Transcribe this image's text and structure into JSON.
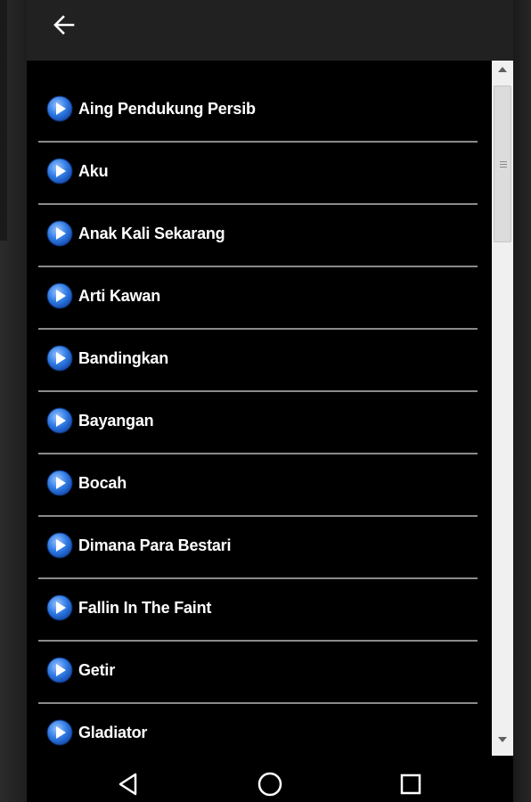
{
  "app_bar": {
    "back_icon": "arrow-left-icon"
  },
  "songs": [
    "Aing Pendukung Persib",
    "Aku",
    "Anak Kali Sekarang",
    "Arti Kawan",
    "Bandingkan",
    "Bayangan",
    "Bocah",
    "Dimana Para Bestari",
    "Fallin In The Faint",
    "Getir",
    "Gladiator"
  ],
  "item_icon": "play-icon",
  "colors": {
    "background": "#000000",
    "app_bar": "#212121",
    "text": "#ffffff",
    "divider": "#8a8a8a",
    "play_icon": "#2f7be5"
  },
  "nav_bar": {
    "icons": [
      "back-triangle-icon",
      "home-circle-icon",
      "recents-square-icon"
    ]
  }
}
